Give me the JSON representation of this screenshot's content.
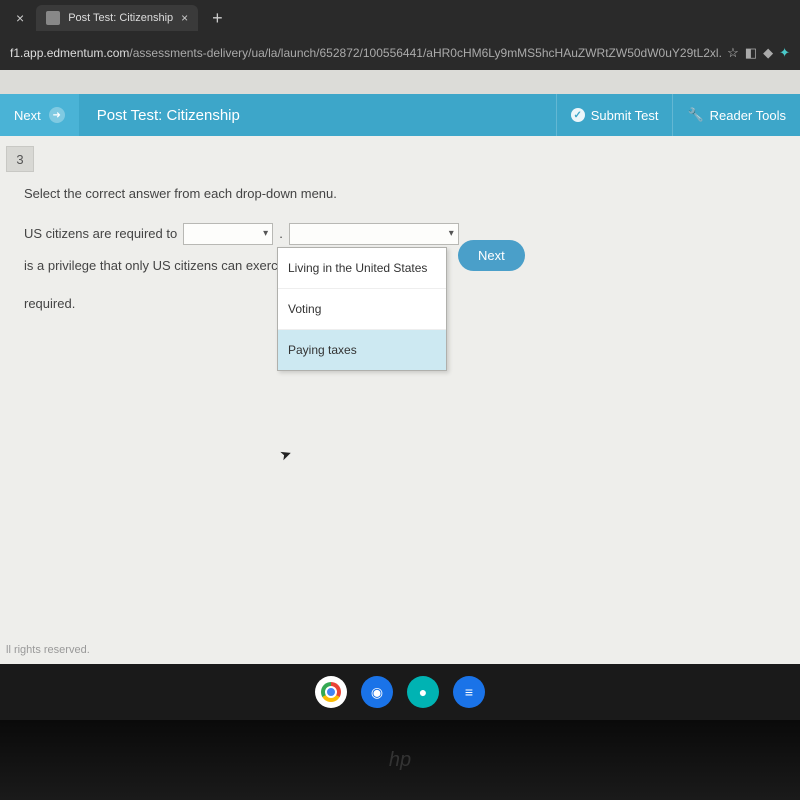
{
  "browser": {
    "tab_title": "Post Test: Citizenship",
    "url_host": "f1.app.edmentum.com",
    "url_path": "/assessments-delivery/ua/la/launch/652872/100556441/aHR0cHM6Ly9mMS5hcHAuZWRtZW50dW0uY29tL2xl..."
  },
  "header": {
    "nav_next": "Next",
    "title": "Post Test: Citizenship",
    "submit": "Submit Test",
    "reader": "Reader Tools"
  },
  "question": {
    "number": "3",
    "instruction": "Select the correct answer from each drop-down menu.",
    "text_before": "US citizens are required to",
    "period": ".",
    "text_after": "is a privilege that only US citizens can exercise, but it is not",
    "required_word": "required.",
    "next_button": "Next"
  },
  "dropdown": {
    "options": {
      "0": "Living in the United States",
      "1": "Voting",
      "2": "Paying taxes"
    }
  },
  "footer": "ll rights reserved.",
  "bezel": "hp"
}
